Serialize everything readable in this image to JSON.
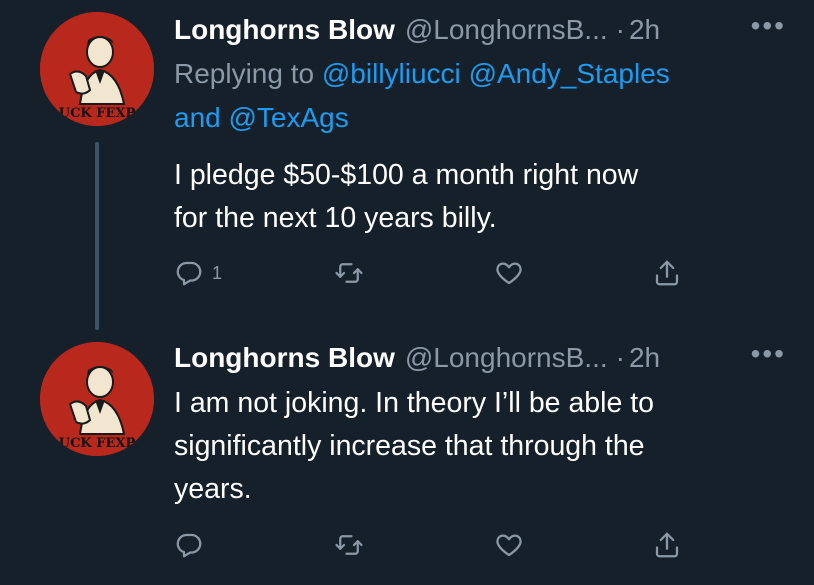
{
  "tweets": [
    {
      "name": "Longhorns Blow",
      "handle": "@LonghornsB...",
      "separator": "·",
      "time": "2h",
      "more": "•••",
      "replying_prefix": "Replying to",
      "mentions": [
        "@billyliucci",
        "@Andy_Staples",
        "@TexAgs"
      ],
      "and_word": "and",
      "text_lines": [
        "I pledge $50-$100 a month right now",
        "for the next 10 years billy."
      ],
      "reply_count": "1",
      "avatar_text": "UCK FEXP"
    },
    {
      "name": "Longhorns Blow",
      "handle": "@LonghornsB...",
      "separator": "·",
      "time": "2h",
      "more": "•••",
      "text_lines": [
        "I am not joking. In theory I’ll be able to",
        "significantly increase that through the",
        "years."
      ],
      "reply_count": "",
      "avatar_text": "UCK FEXP"
    }
  ],
  "icons": {
    "reply": "reply-icon",
    "retweet": "retweet-icon",
    "like": "heart-icon",
    "share": "share-icon"
  },
  "colors": {
    "background": "#15202b",
    "link": "#1d9bf0",
    "secondary": "#8b98a5",
    "avatar": "#b8281c"
  }
}
